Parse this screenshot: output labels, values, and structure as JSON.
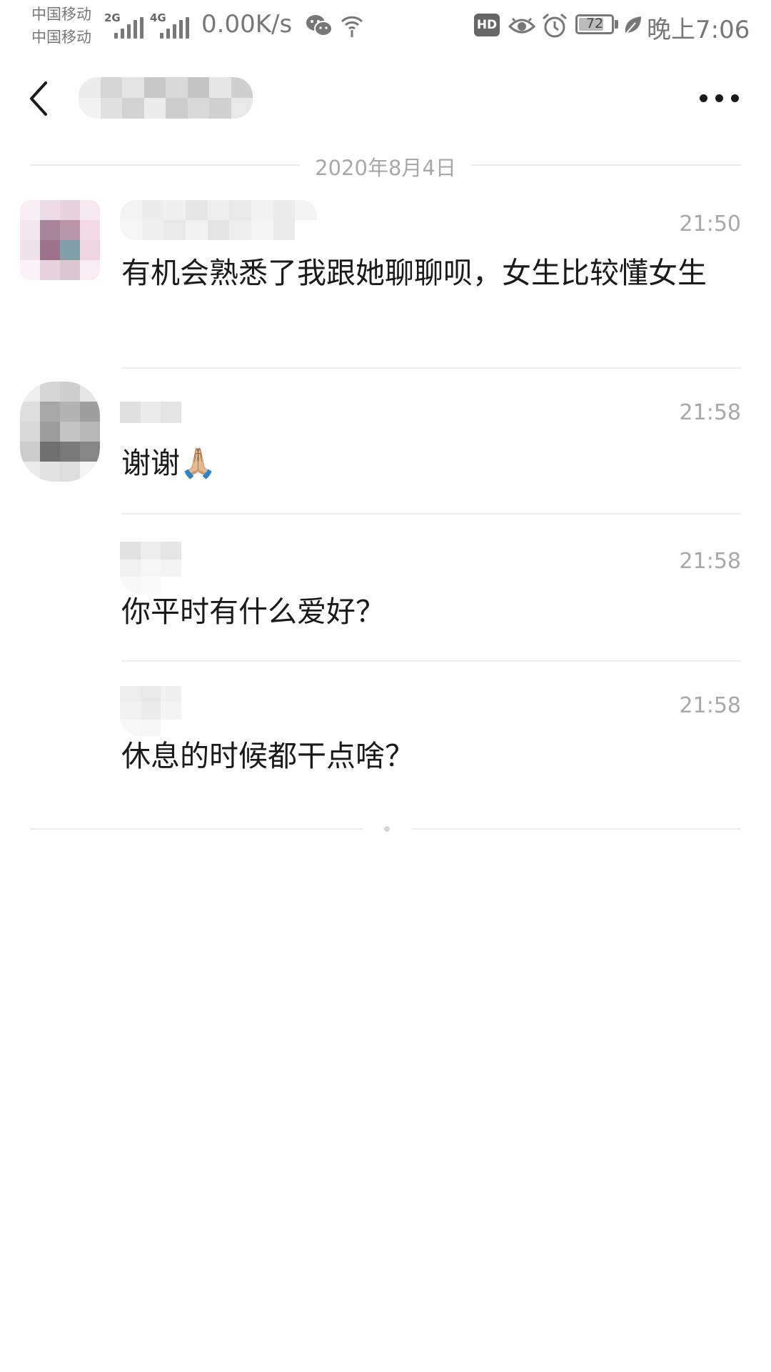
{
  "status_bar": {
    "carrier_1": "中国移动",
    "carrier_2": "中国移动",
    "sim1_network": "2G",
    "sim2_network": "4G",
    "net_speed": "0.00K/s",
    "battery": "72",
    "time": "晚上7:06",
    "icons": [
      "wechat-icon",
      "hotspot-icon",
      "hd-icon",
      "eye-icon",
      "alarm-icon",
      "battery-icon",
      "leaf-icon"
    ]
  },
  "nav": {
    "back_icon": "chevron-left-icon",
    "more_icon": "more-horizontal-icon"
  },
  "date_label": "2020年8月4日",
  "messages": [
    {
      "time": "21:50",
      "text": "有机会熟悉了我跟她聊聊呗，女生比较懂女生"
    },
    {
      "time": "21:58",
      "text": "谢谢🙏🏼"
    },
    {
      "time": "21:58",
      "text": "你平时有什么爱好？"
    },
    {
      "time": "21:58",
      "text": "休息的时候都干点啥？"
    }
  ],
  "colors": {
    "text_primary": "#1a1a1a",
    "text_secondary": "#a8a8a8",
    "divider": "#ececec",
    "status_icon": "#777777"
  }
}
